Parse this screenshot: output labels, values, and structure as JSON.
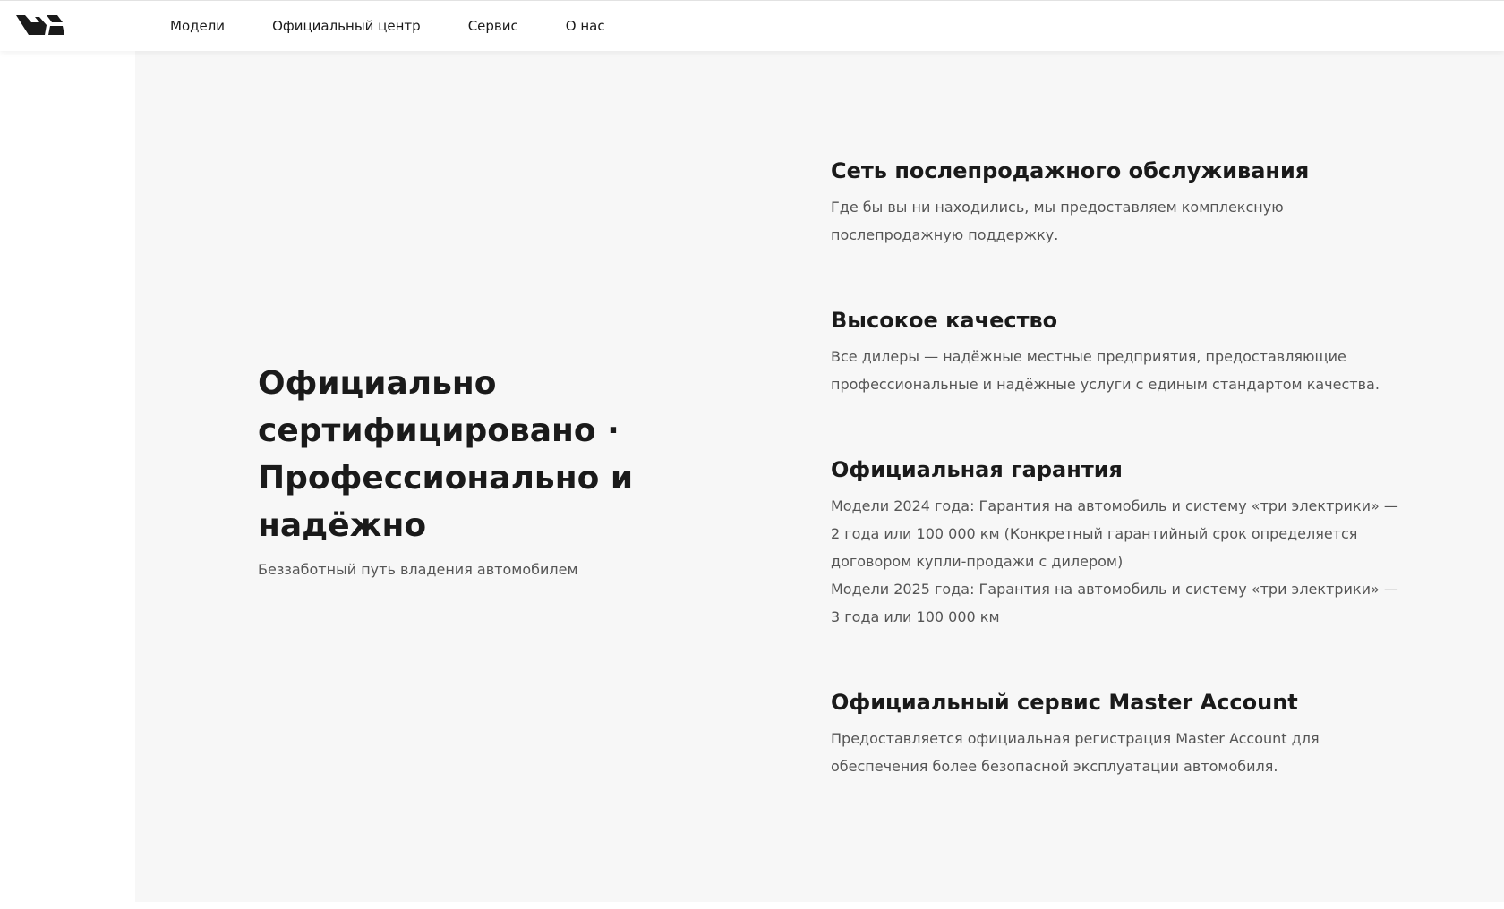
{
  "header": {
    "logo_icon": "brand-logo-icon",
    "nav": [
      {
        "label": "Модели"
      },
      {
        "label": "Официальный центр"
      },
      {
        "label": "Сервис"
      },
      {
        "label": "О нас"
      }
    ]
  },
  "hero": {
    "title": "Официально сертифицировано · Профессионально и надёжно",
    "subtitle": "Беззаботный путь владения автомобилем"
  },
  "features": [
    {
      "title": "Сеть послепродажного обслуживания",
      "lines": [
        "Где бы вы ни находились, мы предоставляем комплексную",
        "послепродажную поддержку."
      ]
    },
    {
      "title": "Высокое качество",
      "lines": [
        "Все дилеры — надёжные местные предприятия, предоставляющие",
        "профессиональные и надёжные услуги с единым стандартом качества."
      ]
    },
    {
      "title": "Официальная гарантия",
      "lines": [
        "Модели 2024 года: Гарантия на автомобиль и систему «три электрики» —",
        "2 года или 100 000 км (Конкретный гарантийный срок определяется",
        "договором купли-продажи с дилером)",
        "Модели 2025 года: Гарантия на автомобиль и систему «три электрики» —",
        "3 года или 100 000 км"
      ]
    },
    {
      "title": "Официальный сервис Master Account",
      "lines": [
        "Предоставляется официальная регистрация Master Account для",
        "обеспечения более безопасной эксплуатации автомобиля."
      ]
    }
  ],
  "colors": {
    "panel_background": "#f7f7f7",
    "text_primary": "#1a1a1a",
    "text_secondary": "#555555"
  }
}
